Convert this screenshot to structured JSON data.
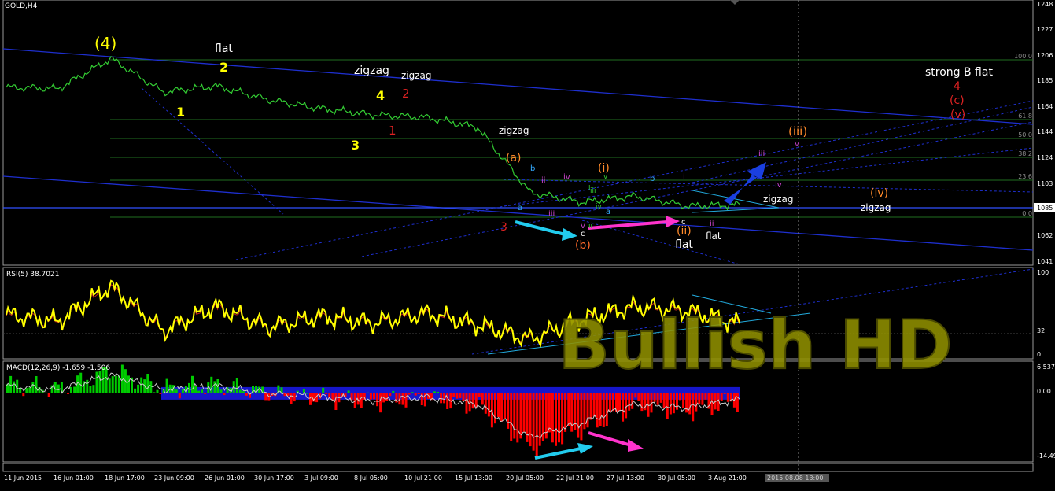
{
  "symbol_title": "GOLD,H4",
  "colors": {
    "background": "#000000",
    "price_line": "#33cc33",
    "grid_level": "#1f6e1f",
    "trend_blue": "#1e2fcf",
    "fib_text": "#8a8a8a",
    "rsi_line": "#ffff00",
    "macd_pos": "#00cc00",
    "macd_neg": "#ff0000",
    "macd_blue": "#1a1aee",
    "cyan_arrow": "#22ccee",
    "magenta_arrow": "#ff33cc",
    "watermark": "#8f8f00"
  },
  "price_axis": {
    "labels": [
      "1248",
      "1227",
      "1206",
      "1185",
      "1164",
      "1144",
      "1124",
      "1103",
      "1085",
      "1062",
      "1041"
    ],
    "current_price": "1085"
  },
  "fib_levels": [
    "100.0",
    "61.8",
    "50.0",
    "38.2",
    "23.6",
    "0.0"
  ],
  "rsi": {
    "title": "RSI(5) 38.7021",
    "axis_labels": [
      "100",
      "32",
      "0"
    ]
  },
  "macd": {
    "title": "MACD(12,26,9) -1.659 -1.506",
    "axis_labels": [
      "6.537",
      "0.00",
      "-14.49"
    ]
  },
  "time_axis": {
    "labels": [
      "11 Jun 2015",
      "16 Jun 01:00",
      "18 Jun 17:00",
      "23 Jun 09:00",
      "26 Jun 01:00",
      "30 Jun 17:00",
      "3 Jul 09:00",
      "8 Jul 05:00",
      "10 Jul 21:00",
      "15 Jul 13:00",
      "20 Jul 05:00",
      "22 Jul 21:00",
      "27 Jul 13:00",
      "30 Jul 05:00",
      "3 Aug 21:00"
    ],
    "cursor_label": "2015.08.08 13:00"
  },
  "watermark": "Bullish HD",
  "annotations": {
    "w4_big": "(4)",
    "flat_1": "flat",
    "y2": "2",
    "y1": "1",
    "zigzag_1": "zigzag",
    "zigzag_2": "zigzag",
    "r2": "2",
    "y4": "4",
    "y3": "3",
    "r1": "1",
    "zigzag_3": "zigzag",
    "a_paren": "(a)",
    "r3": "3",
    "b_paren": "(b)",
    "i_paren": "(i)",
    "ii_paren": "(ii)",
    "flat_2": "flat",
    "flat_3": "flat",
    "iii_paren": "(iii)",
    "iv_paren": "(iv)",
    "zigzag_4": "zigzag",
    "zigzag_5": "zigzag",
    "strong_b_flat": "strong B flat",
    "r4": "4",
    "c_paren": "(c)",
    "v_paren": "(v)",
    "s_a1": "a",
    "s_b1": "b",
    "s_c1": "c",
    "s_ii1": "ii",
    "s_iii1": "iii",
    "s_iv1": "iv",
    "s_v1": "v",
    "s_i2": "i",
    "s_ii2": "ii",
    "s_iii2": "iii",
    "s_iv2": "iv",
    "s_v2": "v",
    "s_a2": "a",
    "s_b2": "b",
    "s_c2": "c",
    "s_i3": "i",
    "s_ii3": "ii",
    "s_iii3": "iii",
    "s_iv3": "iv",
    "s_v3": "v"
  },
  "chart_data": [
    {
      "type": "line",
      "title": "GOLD,H4",
      "ylim": [
        1041,
        1248
      ],
      "x": [
        "11 Jun 2015",
        "16 Jun 01:00",
        "18 Jun 17:00",
        "23 Jun 09:00",
        "26 Jun 01:00",
        "30 Jun 17:00",
        "3 Jul 09:00",
        "8 Jul 05:00",
        "10 Jul 21:00",
        "15 Jul 13:00",
        "20 Jul 05:00",
        "22 Jul 21:00",
        "27 Jul 13:00",
        "30 Jul 05:00",
        "3 Aug 21:00"
      ],
      "series": [
        {
          "name": "GOLD,H4",
          "values": [
            1182,
            1181,
            1205,
            1178,
            1183,
            1172,
            1165,
            1160,
            1158,
            1150,
            1098,
            1090,
            1095,
            1087,
            1088
          ]
        }
      ]
    },
    {
      "type": "line",
      "title": "RSI(5) 38.7021",
      "ylim": [
        0,
        100
      ],
      "values": [
        50,
        42,
        85,
        30,
        60,
        35,
        48,
        40,
        52,
        38,
        20,
        45,
        60,
        55,
        38.7
      ]
    },
    {
      "type": "bar",
      "title": "MACD(12,26,9) -1.659 -1.506",
      "ylim": [
        -14.49,
        6.537
      ],
      "values": [
        2,
        1,
        5,
        1,
        2,
        0,
        -1,
        -2,
        -1,
        -3,
        -12,
        -8,
        -3,
        -4,
        -1.659
      ]
    }
  ]
}
